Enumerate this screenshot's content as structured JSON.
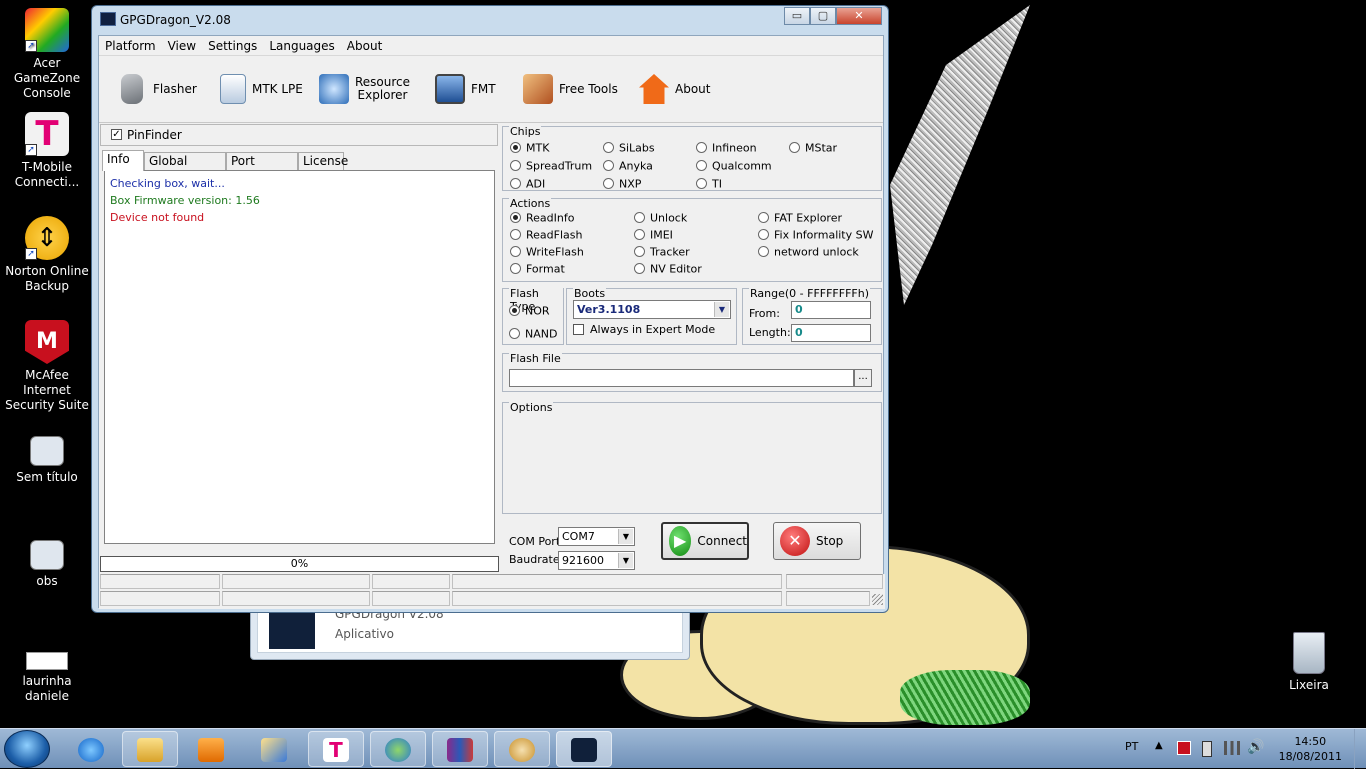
{
  "desktop": {
    "icons": [
      {
        "label_line1": "Acer GameZone",
        "label_line2": "Console"
      },
      {
        "label_line1": "T-Mobile",
        "label_line2": "Connecti..."
      },
      {
        "label_line1": "Norton Online",
        "label_line2": "Backup"
      },
      {
        "label_line1": "McAfee Internet",
        "label_line2": "Security Suite"
      },
      {
        "label_line1": "Sem título",
        "label_line2": ""
      },
      {
        "label_line1": "obs",
        "label_line2": ""
      },
      {
        "label_line1": "laurinha daniele",
        "label_line2": ""
      },
      {
        "label_line1": "Lixeira",
        "label_line2": ""
      }
    ]
  },
  "preview": {
    "title": "GPGDragon V2.08",
    "subtitle": "Aplicativo"
  },
  "window": {
    "title": "GPGDragon_V2.08",
    "caption_min": "▭",
    "caption_max": "▢",
    "caption_close": "✕",
    "menu": [
      "Platform",
      "View",
      "Settings",
      "Languages",
      "About"
    ],
    "toolbar": [
      {
        "line1": "Flasher",
        "line2": "",
        "icon": "phone-icon",
        "color": "#8a8f96"
      },
      {
        "line1": "MTK LPE",
        "line2": "",
        "icon": "document-icon",
        "color": "#7aa0c8"
      },
      {
        "line1": "Resource",
        "line2": "Explorer",
        "icon": "gear-icon",
        "color": "#4a8ad4"
      },
      {
        "line1": "FMT",
        "line2": "",
        "icon": "monitor-icon",
        "color": "#3a6eb8"
      },
      {
        "line1": "Free Tools",
        "line2": "",
        "icon": "tools-icon",
        "color": "#c86a2a"
      },
      {
        "line1": "About",
        "line2": "",
        "icon": "house-icon",
        "color": "#e07020"
      }
    ],
    "pinfinder": {
      "label": "PinFinder",
      "checked": true
    },
    "tabs": [
      "Info",
      "Global Settings",
      "Port Monitor",
      "License"
    ],
    "log": [
      {
        "text": "Checking box, wait...",
        "color": "#1c2fa8"
      },
      {
        "text": "Box Firmware version: 1.56",
        "color": "#1f7a1f"
      },
      {
        "text": "Device not found",
        "color": "#c8101e"
      }
    ],
    "progress": "0%",
    "chips": {
      "title": "Chips",
      "items": [
        "MTK",
        "SiLabs",
        "Infineon",
        "MStar",
        "SpreadTrum",
        "Anyka",
        "Qualcomm",
        "ADI",
        "NXP",
        "TI"
      ],
      "selected": "MTK"
    },
    "actions": {
      "title": "Actions",
      "items": [
        "ReadInfo",
        "Unlock",
        "FAT Explorer",
        "ReadFlash",
        "IMEI",
        "Fix Informality SW",
        "WriteFlash",
        "Tracker",
        "netword unlock",
        "Format",
        "NV Editor"
      ],
      "selected": "ReadInfo"
    },
    "flash_type": {
      "title": "Flash Type",
      "items": [
        "NOR",
        "NAND"
      ],
      "selected": "NOR"
    },
    "boots": {
      "title": "Boots",
      "value": "Ver3.1108",
      "expert_label": "Always in Expert Mode"
    },
    "range": {
      "title": "Range(0 - FFFFFFFFh)",
      "from_label": "From:",
      "from_value": "0",
      "length_label": "Length:",
      "length_value": "0"
    },
    "flash_file": {
      "title": "Flash File",
      "browse": "..."
    },
    "options": {
      "title": "Options"
    },
    "com_port": {
      "label": "COM Port",
      "value": "COM7"
    },
    "baudrate": {
      "label": "Baudrate",
      "value": "921600"
    },
    "connect_label": "Connect",
    "stop_label": "Stop"
  },
  "taskbar": {
    "language": "PT",
    "time": "14:50",
    "date": "18/08/2011"
  }
}
